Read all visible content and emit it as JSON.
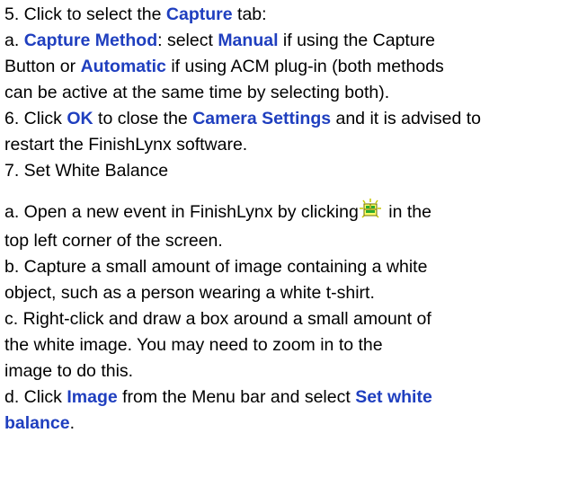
{
  "colors": {
    "keyword": "#1f3fbf",
    "text": "#000000",
    "background": "#ffffff"
  },
  "icon": {
    "name": "new-event-icon"
  },
  "step5": {
    "prefix": "5. Click to select the ",
    "capture": "Capture",
    "suffix": " tab:"
  },
  "step5a": {
    "prefix": "a. ",
    "capture_method": "Capture Method",
    "mid1": ": select ",
    "manual": "Manual",
    "mid2": " if using the Capture",
    "l2_prefix": "Button or ",
    "automatic": "Automatic",
    "l2_suffix": " if using ACM plug-in (both methods",
    "l3": "can be active at the same time by selecting both)."
  },
  "step6": {
    "prefix": "6. Click ",
    "ok": "OK",
    "mid": " to close the ",
    "camera_settings": "Camera Settings",
    "suffix": " and it is advised to",
    "l2": "restart the FinishLynx software."
  },
  "step7": {
    "title": "7. Set White Balance"
  },
  "step7a": {
    "prefix": "a. Open a new event in FinishLynx by clicking",
    "suffix": " in the",
    "l2": "top left corner of the screen."
  },
  "step7b": {
    "l1": "b. Capture a small amount of image containing a white",
    "l2": "object, such as a person wearing a white t-shirt."
  },
  "step7c": {
    "l1": "c. Right-click and draw a box around a small amount of",
    "l2": "the white image. You may need to zoom in to the",
    "l3": "image to do this."
  },
  "step7d": {
    "prefix": "d. Click ",
    "image": "Image",
    "mid": " from the Menu bar and select ",
    "set_white": "Set white",
    "balance": "balance",
    "end": "."
  }
}
